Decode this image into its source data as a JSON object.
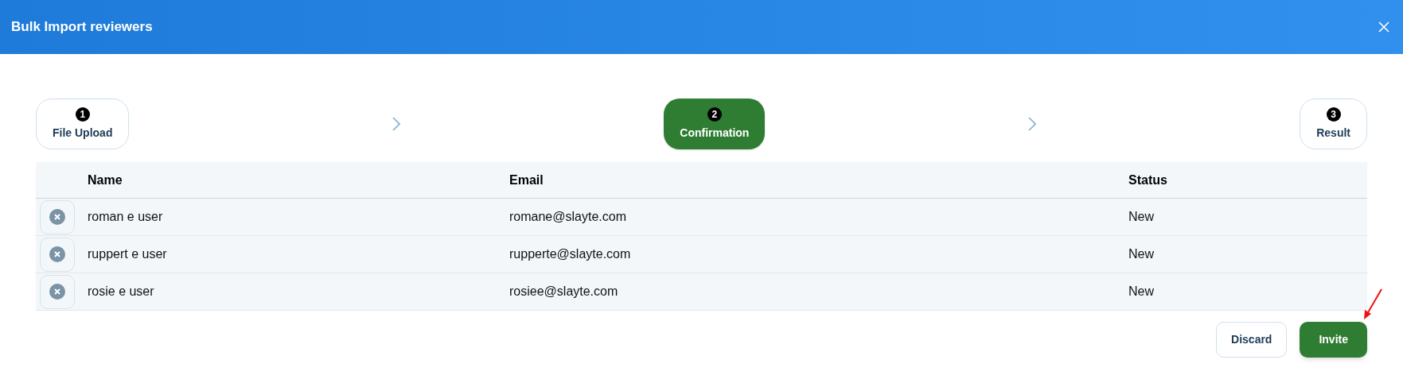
{
  "dialog": {
    "title": "Bulk Import reviewers"
  },
  "steps": [
    {
      "number": "1",
      "label": "File Upload",
      "selected": false
    },
    {
      "number": "2",
      "label": "Confirmation",
      "selected": true
    },
    {
      "number": "3",
      "label": "Result",
      "selected": false
    }
  ],
  "table": {
    "columns": [
      "Name",
      "Email",
      "Status"
    ],
    "rows": [
      {
        "name": "roman e user",
        "email": "romane@slayte.com",
        "status": "New"
      },
      {
        "name": "ruppert e user",
        "email": "rupperte@slayte.com",
        "status": "New"
      },
      {
        "name": "rosie e user",
        "email": "rosiee@slayte.com",
        "status": "New"
      }
    ]
  },
  "buttons": [
    {
      "label": "Discard",
      "kind": "secondary"
    },
    {
      "label": "Invite",
      "kind": "primary"
    }
  ]
}
